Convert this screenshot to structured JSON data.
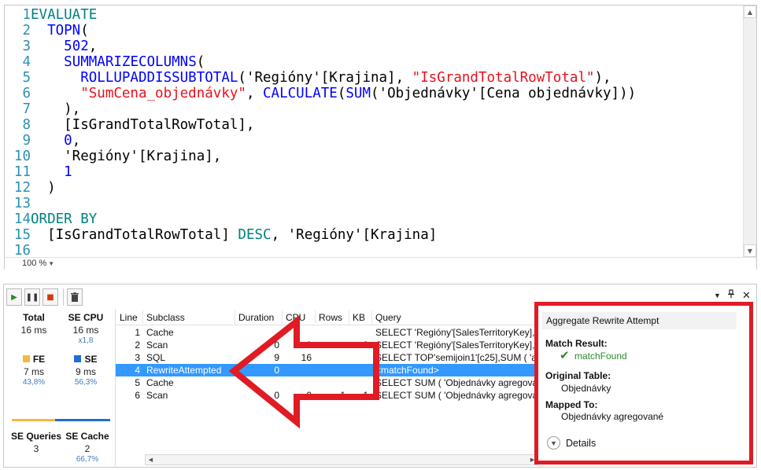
{
  "editor": {
    "line_numbers": [
      "1",
      "2",
      "3",
      "4",
      "5",
      "6",
      "7",
      "8",
      "9",
      "10",
      "11",
      "12",
      "13",
      "14",
      "15",
      "16"
    ],
    "lines": [
      [
        {
          "c": "fn-teal",
          "t": "EVALUATE"
        }
      ],
      [
        {
          "c": "txt",
          "t": "  "
        },
        {
          "c": "kw",
          "t": "TOPN"
        },
        {
          "c": "txt",
          "t": "("
        }
      ],
      [
        {
          "c": "txt",
          "t": "    "
        },
        {
          "c": "kw",
          "t": "502"
        },
        {
          "c": "txt",
          "t": ","
        }
      ],
      [
        {
          "c": "txt",
          "t": "    "
        },
        {
          "c": "kw",
          "t": "SUMMARIZECOLUMNS"
        },
        {
          "c": "txt",
          "t": "("
        }
      ],
      [
        {
          "c": "txt",
          "t": "      "
        },
        {
          "c": "kw",
          "t": "ROLLUPADDISSUBTOTAL"
        },
        {
          "c": "txt",
          "t": "('Regióny'[Krajina], "
        },
        {
          "c": "str",
          "t": "\"IsGrandTotalRowTotal\""
        },
        {
          "c": "txt",
          "t": "),"
        }
      ],
      [
        {
          "c": "txt",
          "t": "      "
        },
        {
          "c": "str",
          "t": "\"SumCena_objednávky\""
        },
        {
          "c": "txt",
          "t": ", "
        },
        {
          "c": "kw",
          "t": "CALCULATE"
        },
        {
          "c": "txt",
          "t": "("
        },
        {
          "c": "kw",
          "t": "SUM"
        },
        {
          "c": "txt",
          "t": "('Objednávky'[Cena objednávky]))"
        }
      ],
      [
        {
          "c": "txt",
          "t": "    ),"
        }
      ],
      [
        {
          "c": "txt",
          "t": "    [IsGrandTotalRowTotal],"
        }
      ],
      [
        {
          "c": "txt",
          "t": "    "
        },
        {
          "c": "kw",
          "t": "0"
        },
        {
          "c": "txt",
          "t": ","
        }
      ],
      [
        {
          "c": "txt",
          "t": "    'Regióny'[Krajina],"
        }
      ],
      [
        {
          "c": "txt",
          "t": "    "
        },
        {
          "c": "kw",
          "t": "1"
        }
      ],
      [
        {
          "c": "txt",
          "t": "  )"
        }
      ],
      [
        {
          "c": "txt",
          "t": ""
        }
      ],
      [
        {
          "c": "fn-teal",
          "t": "ORDER BY"
        }
      ],
      [
        {
          "c": "txt",
          "t": "  [IsGrandTotalRowTotal] "
        },
        {
          "c": "fn-teal",
          "t": "DESC"
        },
        {
          "c": "txt",
          "t": ", 'Regióny'[Krajina]"
        }
      ],
      [
        {
          "c": "txt",
          "t": ""
        }
      ]
    ],
    "zoom": "100 %"
  },
  "stats": {
    "total_label": "Total",
    "total_value": "16 ms",
    "secpu_label": "SE CPU",
    "secpu_value": "16 ms",
    "secpu_sub": "x1,8",
    "fe_label": "FE",
    "fe_value": "7 ms",
    "fe_pct": "43,8%",
    "se_label": "SE",
    "se_value": "9 ms",
    "se_pct": "56,3%",
    "fe_color": "#f5b942",
    "se_color": "#1f6fd1",
    "fe_fraction": 0.438,
    "sequeries_label": "SE Queries",
    "sequeries_value": "3",
    "secache_label": "SE Cache",
    "secache_value": "2",
    "secache_pct": "66,7%"
  },
  "grid": {
    "headers": [
      "Line",
      "Subclass",
      "Duration",
      "CPU",
      "Rows",
      "KB",
      "Query"
    ],
    "rows": [
      {
        "line": "1",
        "subclass": "Cache",
        "duration": "",
        "cpu": "",
        "rows": "",
        "kb": "",
        "query": "SELECT 'Regióny'[SalesTerritoryKey], 'Re"
      },
      {
        "line": "2",
        "subclass": "Scan",
        "duration": "0",
        "cpu": "0",
        "rows": "",
        "kb": "2",
        "query": "SELECT 'Regióny'[SalesTerritoryKey], 'Re"
      },
      {
        "line": "3",
        "subclass": "SQL",
        "duration": "9",
        "cpu": "16",
        "rows": "",
        "kb": "",
        "query": "SELECT  TOP'semijoin1'[c25],SUM ( 'a0'"
      },
      {
        "line": "4",
        "subclass": "RewriteAttempted",
        "duration": "0",
        "cpu": "",
        "rows": "",
        "kb": "",
        "query": "<matchFound>"
      },
      {
        "line": "5",
        "subclass": "Cache",
        "duration": "",
        "cpu": "",
        "rows": "",
        "kb": "",
        "query": "SELECT SUM ( 'Objednávky agregované"
      },
      {
        "line": "6",
        "subclass": "Scan",
        "duration": "0",
        "cpu": "0",
        "rows": "1",
        "kb": "1",
        "query": "SELECT SUM ( 'Objednávky agregované"
      }
    ],
    "selected_index": 3
  },
  "details": {
    "title": "Aggregate Rewrite Attempt",
    "match_label": "Match Result:",
    "match_value": "matchFound",
    "orig_label": "Original Table:",
    "orig_value": "Objednávky",
    "mapped_label": "Mapped To:",
    "mapped_value": "Objednávky agregované",
    "more_label": "Details"
  },
  "colors": {
    "annotation_red": "#e01b24",
    "selection_blue": "#3399ff"
  }
}
